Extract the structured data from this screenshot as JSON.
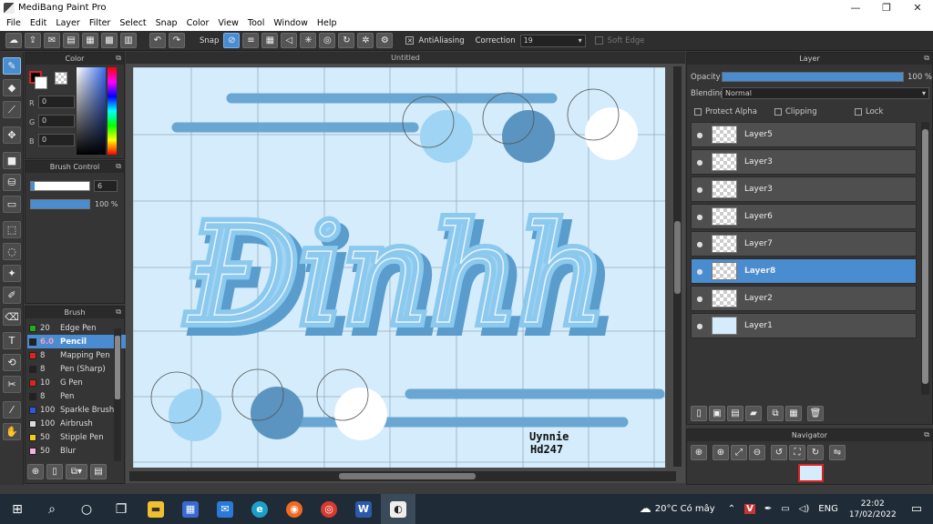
{
  "window": {
    "title": "MediBang Paint Pro",
    "minimize": "—",
    "maximize": "❐",
    "close": "✕"
  },
  "menu": [
    "File",
    "Edit",
    "Layer",
    "Filter",
    "Select",
    "Snap",
    "Color",
    "View",
    "Tool",
    "Window",
    "Help"
  ],
  "toolbar": {
    "snap_label": "Snap",
    "antialiasing_label": "AntiAliasing",
    "antialiasing_checked": "✕",
    "correction_label": "Correction",
    "correction_value": "19",
    "soft_edge_label": "Soft Edge"
  },
  "color_panel": {
    "title": "Color",
    "r_label": "R",
    "g_label": "G",
    "b_label": "B",
    "r_value": "0",
    "g_value": "0",
    "b_value": "0",
    "primary": "#000000",
    "secondary": "#ffffff"
  },
  "brush_control": {
    "title": "Brush Control",
    "size_value": "6",
    "opacity_value": "100 %"
  },
  "brush_panel": {
    "title": "Brush",
    "items": [
      {
        "size": "20",
        "name": "Edge Pen",
        "color": "#22aa22"
      },
      {
        "size": "6.0",
        "name": "Pencil",
        "color": "#222222"
      },
      {
        "size": "8",
        "name": "Mapping Pen",
        "color": "#dd2222"
      },
      {
        "size": "8",
        "name": "Pen (Sharp)",
        "color": "#222222"
      },
      {
        "size": "10",
        "name": "G Pen",
        "color": "#dd2222"
      },
      {
        "size": "8",
        "name": "Pen",
        "color": "#222222"
      },
      {
        "size": "100",
        "name": "Sparkle Brush",
        "color": "#3355dd"
      },
      {
        "size": "100",
        "name": "Airbrush",
        "color": "#dddddd"
      },
      {
        "size": "50",
        "name": "Stipple Pen",
        "color": "#eecc22"
      },
      {
        "size": "50",
        "name": "Blur",
        "color": "#f3b3e0"
      }
    ]
  },
  "document": {
    "tab_title": "Untitled"
  },
  "artwork": {
    "lettering": "Đinhh",
    "signature_line1": "Uynnie",
    "signature_line2": "Hd247"
  },
  "layer_panel": {
    "title": "Layer",
    "opacity_label": "Opacity",
    "opacity_value": "100 %",
    "opacity_fraction": 1.0,
    "blending_label": "Blending",
    "blending_value": "Normal",
    "protect_alpha_label": "Protect Alpha",
    "clipping_label": "Clipping",
    "lock_label": "Lock",
    "layers": [
      {
        "name": "Layer5",
        "thumb": "transparent"
      },
      {
        "name": "Layer3",
        "thumb": "transparent"
      },
      {
        "name": "Layer3",
        "thumb": "transparent"
      },
      {
        "name": "Layer6",
        "thumb": "transparent"
      },
      {
        "name": "Layer7",
        "thumb": "transparent"
      },
      {
        "name": "Layer8",
        "thumb": "transparent",
        "selected": true
      },
      {
        "name": "Layer2",
        "thumb": "transparent"
      },
      {
        "name": "Layer1",
        "thumb": "blue"
      }
    ]
  },
  "navigator": {
    "title": "Navigator"
  },
  "taskbar": {
    "weather": "20°C Có mây",
    "language": "ENG",
    "time": "22:02",
    "date": "17/02/2022"
  },
  "colors": {
    "accent": "#4a8cd0",
    "canvas_bg": "#d4ecfb",
    "stroke_light": "#8cc9ee",
    "stroke_dark": "#5a9ccc"
  }
}
